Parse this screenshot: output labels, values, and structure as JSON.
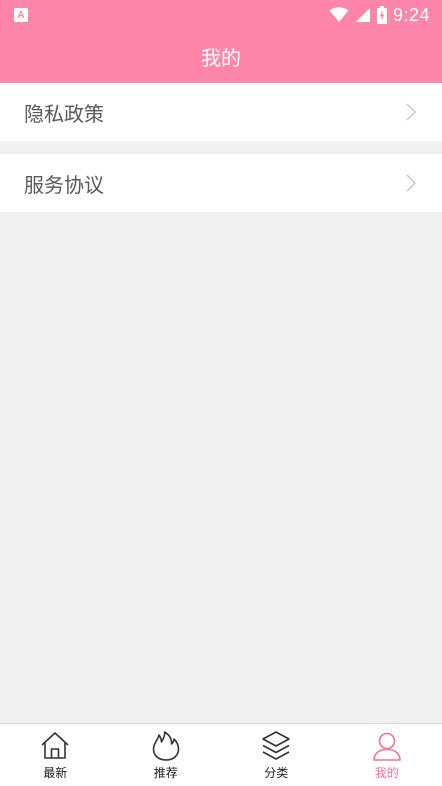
{
  "status_bar": {
    "app_badge": "A",
    "time": "9:24",
    "icons": [
      "wifi-icon",
      "cellular-signal-icon",
      "battery-charging-icon"
    ]
  },
  "header": {
    "title": "我的"
  },
  "menu": {
    "items": [
      {
        "label": "隐私政策",
        "icon": "chevron-right-icon"
      },
      {
        "label": "服务协议",
        "icon": "chevron-right-icon"
      }
    ]
  },
  "bottom_nav": {
    "items": [
      {
        "label": "最新",
        "icon": "home-icon",
        "active": false
      },
      {
        "label": "推荐",
        "icon": "flame-icon",
        "active": false
      },
      {
        "label": "分类",
        "icon": "layers-icon",
        "active": false
      },
      {
        "label": "我的",
        "icon": "user-icon",
        "active": true
      }
    ]
  },
  "colors": {
    "brand": "#ff86a8",
    "active_tab": "#ff6f9a",
    "background": "#f0f0f0"
  }
}
